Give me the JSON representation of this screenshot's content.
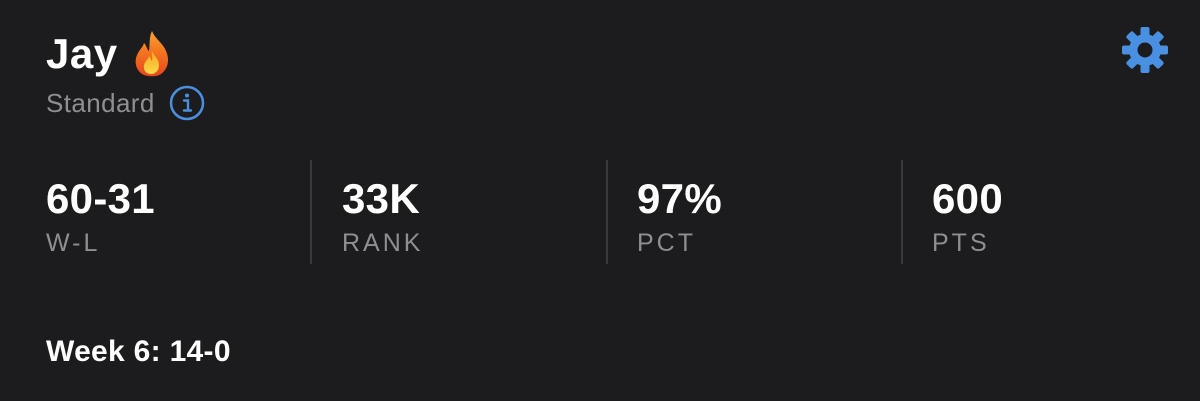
{
  "profile": {
    "name": "Jay",
    "status_emoji_icon": "fire-icon",
    "league_type": "Standard",
    "info_icon": "info-icon"
  },
  "settings_icon": "gear-icon",
  "stats": [
    {
      "value": "60-31",
      "label": "W-L"
    },
    {
      "value": "33K",
      "label": "RANK"
    },
    {
      "value": "97%",
      "label": "PCT"
    },
    {
      "value": "600",
      "label": "PTS"
    }
  ],
  "week_summary": "Week 6: 14-0",
  "colors": {
    "background": "#1c1c1e",
    "accent": "#4a90e2",
    "muted_text": "#8e8e93",
    "divider": "#3a3a3c"
  }
}
